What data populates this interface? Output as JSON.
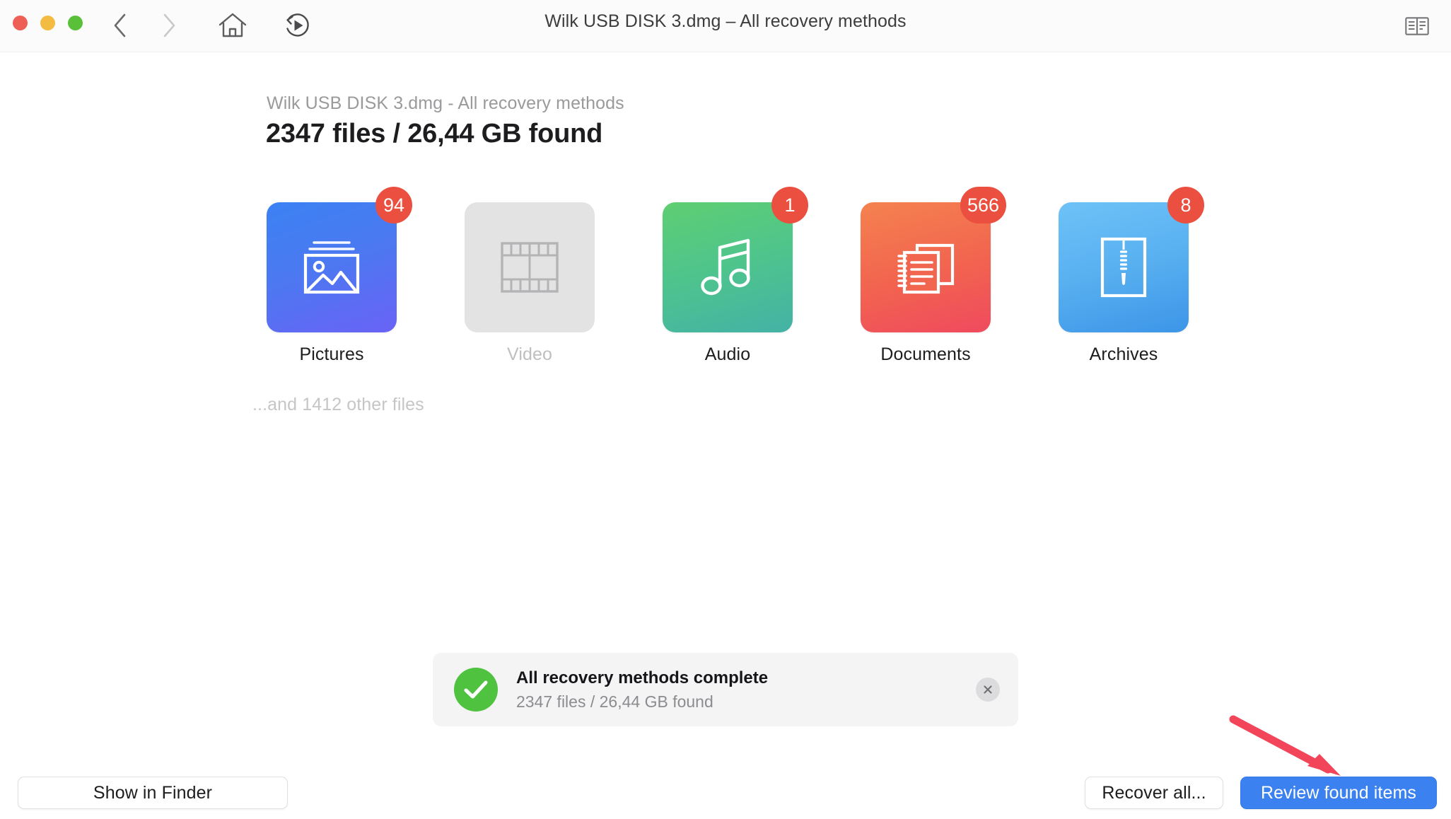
{
  "window": {
    "title": "Wilk USB DISK 3.dmg – All recovery methods",
    "traffic_lights": {
      "close": "close-button",
      "minimize": "minimize-button",
      "maximize": "maximize-button"
    },
    "back_icon": "chevron-left-icon",
    "forward_icon": "chevron-right-icon",
    "home_icon": "home-icon",
    "replay_icon": "replay-scan-icon",
    "reader_icon": "reader-view-icon",
    "colors": {
      "close": "#ee5f55",
      "minimize": "#f3bb41",
      "maximize": "#5ac039"
    }
  },
  "header": {
    "subtitle": "Wilk USB DISK 3.dmg - All recovery methods",
    "title": "2347 files / 26,44 GB found"
  },
  "categories": [
    {
      "label": "Pictures",
      "badge": "94",
      "icon": "picture-icon",
      "enabled": true
    },
    {
      "label": "Video",
      "badge": "",
      "icon": "film-icon",
      "enabled": false
    },
    {
      "label": "Audio",
      "badge": "1",
      "icon": "music-note-icon",
      "enabled": true
    },
    {
      "label": "Documents",
      "badge": "566",
      "icon": "documents-icon",
      "enabled": true
    },
    {
      "label": "Archives",
      "badge": "8",
      "icon": "zip-icon",
      "enabled": true
    }
  ],
  "other_files": "...and 1412 other files",
  "notification": {
    "status_icon": "checkmark-icon",
    "title": "All recovery methods complete",
    "subtitle": "2347 files / 26,44 GB found",
    "close_icon": "close-icon",
    "accent": "#4fc23f"
  },
  "footer": {
    "show_in_finder": "Show in Finder",
    "recover_all": "Recover all...",
    "review_found_items": "Review found items",
    "primary_color": "#3b82f0"
  },
  "annotation": {
    "arrow_icon": "red-pointer-arrow",
    "color": "#f2455a",
    "points_to": "review-found-items-button"
  }
}
